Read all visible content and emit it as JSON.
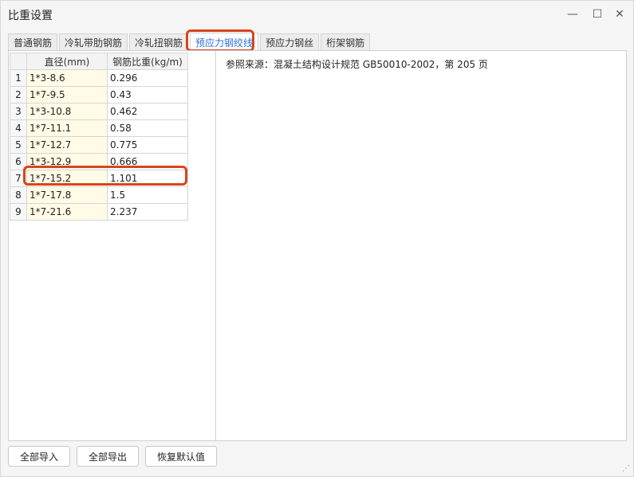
{
  "window": {
    "title": "比重设置",
    "minimize_glyph": "—",
    "maximize_glyph": "☐",
    "close_glyph": "✕"
  },
  "tabs": [
    {
      "label": "普通钢筋",
      "active": false
    },
    {
      "label": "冷轧带肋钢筋",
      "active": false
    },
    {
      "label": "冷轧扭钢筋",
      "active": false
    },
    {
      "label": "预应力钢绞线",
      "active": true
    },
    {
      "label": "预应力钢丝",
      "active": false
    },
    {
      "label": "桁架钢筋",
      "active": false
    }
  ],
  "table": {
    "columns": [
      "",
      "直径(mm)",
      "钢筋比重(kg/m)"
    ],
    "rows": [
      {
        "index": "1",
        "diameter": "1*3-8.6",
        "weight": "0.296"
      },
      {
        "index": "2",
        "diameter": "1*7-9.5",
        "weight": "0.43"
      },
      {
        "index": "3",
        "diameter": "1*3-10.8",
        "weight": "0.462"
      },
      {
        "index": "4",
        "diameter": "1*7-11.1",
        "weight": "0.58"
      },
      {
        "index": "5",
        "diameter": "1*7-12.7",
        "weight": "0.775"
      },
      {
        "index": "6",
        "diameter": "1*3-12.9",
        "weight": "0.666"
      },
      {
        "index": "7",
        "diameter": "1*7-15.2",
        "weight": "1.101"
      },
      {
        "index": "8",
        "diameter": "1*7-17.8",
        "weight": "1.5"
      },
      {
        "index": "9",
        "diameter": "1*7-21.6",
        "weight": "2.237"
      }
    ]
  },
  "reference": "参照来源：混凝土结构设计规范 GB50010-2002，第 205 页",
  "buttons": {
    "import_all": "全部导入",
    "export_all": "全部导出",
    "restore_default": "恢复默认值"
  },
  "colors": {
    "highlight": "#d6461d",
    "active_tab_text": "#2a6fd6",
    "diameter_cell_bg": "#fffbe6"
  }
}
